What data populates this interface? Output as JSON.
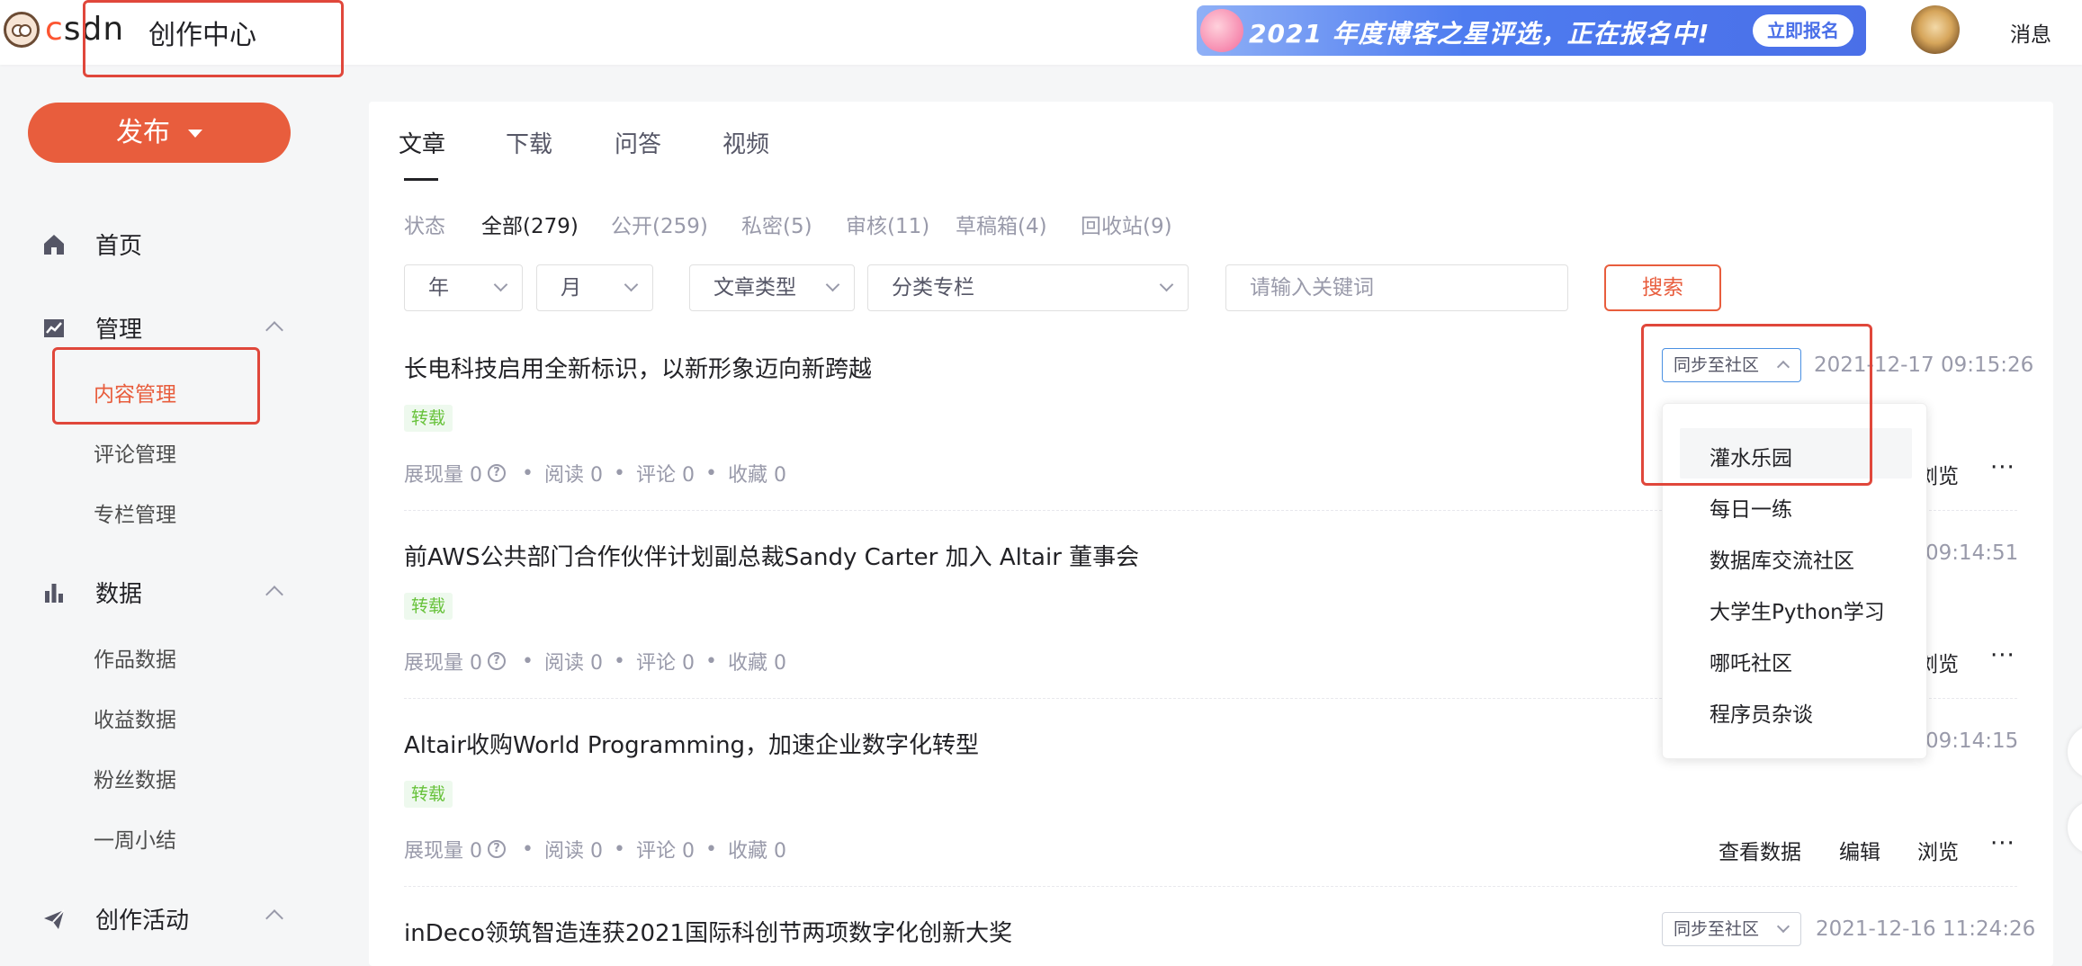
{
  "header": {
    "logo_text_a": "c",
    "logo_text_b": "sdn",
    "title": "创作中心",
    "banner_text": "2021 年度博客之星评选，正在报名中!",
    "banner_button": "立即报名",
    "messages_label": "消息"
  },
  "sidebar": {
    "publish_label": "发布",
    "home_label": "首页",
    "manage_label": "管理",
    "manage_items": [
      "内容管理",
      "评论管理",
      "专栏管理"
    ],
    "data_label": "数据",
    "data_items": [
      "作品数据",
      "收益数据",
      "粉丝数据",
      "一周小结"
    ],
    "activity_label": "创作活动"
  },
  "tabs": [
    "文章",
    "下载",
    "问答",
    "视频"
  ],
  "filters": {
    "status_label": "状态",
    "items": [
      "全部(279)",
      "公开(259)",
      "私密(5)",
      "审核(11)",
      "草稿箱(4)",
      "回收站(9)"
    ]
  },
  "search": {
    "year": "年",
    "month": "月",
    "type": "文章类型",
    "column": "分类专栏",
    "placeholder": "请输入关键词",
    "button": "搜索"
  },
  "articles": [
    {
      "title": "长电科技启用全新标识，以新形象迈向新跨越",
      "tag": "转载",
      "date": "2021-12-17 09:15:26",
      "views_label": "展现量 0",
      "reads": "阅读 0",
      "comments": "评论 0",
      "favorites": "收藏 0",
      "sync_label": "同步至社区",
      "action_browse": "浏览"
    },
    {
      "title": "前AWS公共部门合作伙伴计划副总裁Sandy Carter 加入 Altair 董事会",
      "tag": "转载",
      "date_partial": "7 09:14:51",
      "views_label": "展现量 0",
      "reads": "阅读 0",
      "comments": "评论 0",
      "favorites": "收藏 0",
      "action_browse": "浏览"
    },
    {
      "title": "Altair收购World Programming，加速企业数字化转型",
      "tag": "转载",
      "date_partial": "7 09:14:15",
      "views_label": "展现量 0",
      "reads": "阅读 0",
      "comments": "评论 0",
      "favorites": "收藏 0",
      "action_data": "查看数据",
      "action_edit": "编辑",
      "action_browse": "浏览"
    },
    {
      "title": "inDeco领筑智造连获2021国际科创节两项数字化创新大奖",
      "date": "2021-12-16 11:24:26",
      "sync_label": "同步至社区"
    }
  ],
  "more_symbol": "···",
  "help_symbol": "?",
  "stat_separator": "•",
  "dropdown_items": [
    "灌水乐园",
    "每日一练",
    "数据库交流社区",
    "大学生Python学习",
    "哪吒社区",
    "程序员杂谈"
  ]
}
